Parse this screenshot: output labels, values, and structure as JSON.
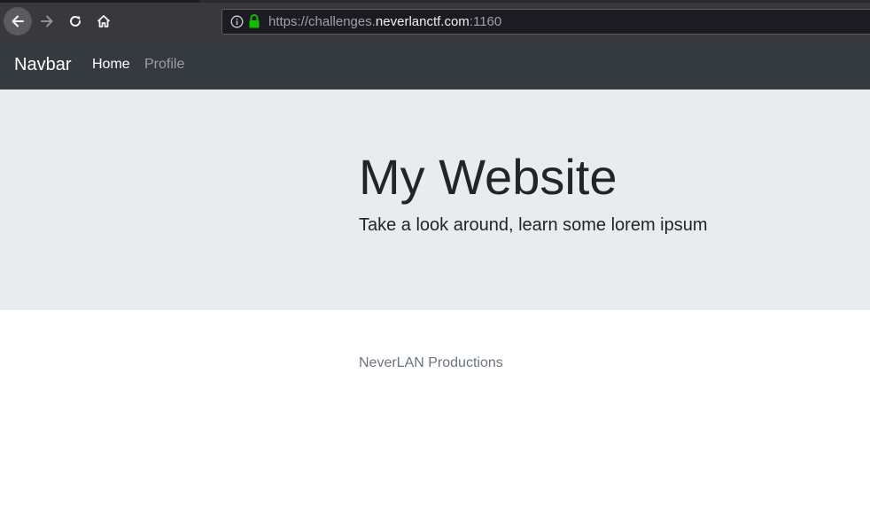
{
  "browser": {
    "url_prefix": "https://challenges.",
    "url_domain": "neverlanctf.com",
    "url_port": ":1160",
    "icons": [
      "back-arrow-icon",
      "forward-arrow-icon",
      "reload-icon",
      "home-icon",
      "info-icon",
      "lock-icon"
    ],
    "colors": {
      "toolbar": "#38383d",
      "lock": "#12bc00"
    }
  },
  "navbar": {
    "brand": "Navbar",
    "links": [
      {
        "label": "Home",
        "active": true
      },
      {
        "label": "Profile",
        "active": false
      }
    ],
    "colors": {
      "background": "#343a40"
    }
  },
  "jumbotron": {
    "title": "My Website",
    "lead": "Take a look around, learn some lorem ipsum",
    "colors": {
      "background": "#e9ecef"
    }
  },
  "footer": {
    "text": "NeverLAN Productions"
  }
}
